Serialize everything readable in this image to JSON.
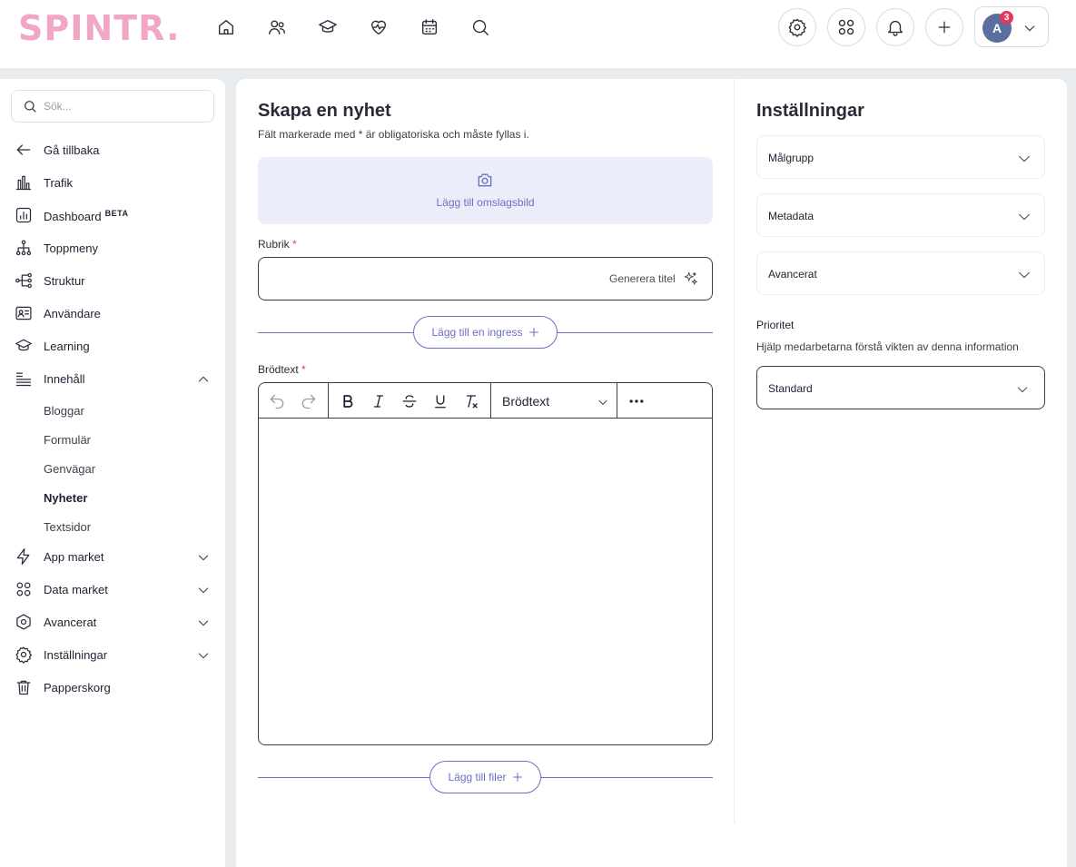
{
  "header": {
    "logo_text": "SPINTR.",
    "nav_icons": [
      "home-icon",
      "people-icon",
      "graduation-cap-icon",
      "heart-pulse-icon",
      "calendar-icon",
      "search-icon"
    ],
    "action_icons": [
      "gear-icon",
      "apps-grid-icon",
      "bell-icon",
      "plus-icon"
    ],
    "user": {
      "initial": "A",
      "notification_count": "3"
    }
  },
  "sidebar": {
    "search_placeholder": "Sök...",
    "items": [
      {
        "label": "Gå tillbaka",
        "icon": "arrow-left-icon"
      },
      {
        "label": "Trafik",
        "icon": "bar-chart-icon"
      },
      {
        "label": "Dashboard",
        "badge": "BETA",
        "icon": "dashboard-icon"
      },
      {
        "label": "Toppmeny",
        "icon": "sitemap-icon"
      },
      {
        "label": "Struktur",
        "icon": "hierarchy-icon"
      },
      {
        "label": "Användare",
        "icon": "id-card-icon"
      },
      {
        "label": "Learning",
        "icon": "graduation-cap-icon"
      },
      {
        "label": "Innehåll",
        "icon": "list-icon",
        "expanded": true
      }
    ],
    "sub_items": [
      {
        "label": "Bloggar"
      },
      {
        "label": "Formulär"
      },
      {
        "label": "Genvägar"
      },
      {
        "label": "Nyheter",
        "active": true
      },
      {
        "label": "Textsidor"
      }
    ],
    "bottom_items": [
      {
        "label": "App market",
        "icon": "lightning-icon"
      },
      {
        "label": "Data market",
        "icon": "grid-icon"
      },
      {
        "label": "Avancerat",
        "icon": "hexagon-icon"
      },
      {
        "label": "Inställningar",
        "icon": "gear-icon"
      },
      {
        "label": "Papperskorg",
        "icon": "trash-icon"
      }
    ]
  },
  "form": {
    "title": "Skapa en nyhet",
    "hint": "Fält markerade med * är obligatoriska och måste fyllas i.",
    "cover_label": "Lägg till omslagsbild",
    "headline_label": "Rubrik",
    "required_mark": "*",
    "headline_value": "",
    "generate_title": "Generera titel",
    "add_ingress": "Lägg till en ingress",
    "body_label": "Brödtext",
    "text_style": "Brödtext",
    "add_files": "Lägg till filer"
  },
  "settings": {
    "title": "Inställningar",
    "accordions": [
      {
        "label": "Målgrupp"
      },
      {
        "label": "Metadata"
      },
      {
        "label": "Avancerat"
      }
    ],
    "priority_label": "Prioritet",
    "priority_hint": "Hjälp medarbetarna förstå vikten av denna information",
    "priority_value": "Standard"
  },
  "colors": {
    "accent": "#6b6fc4",
    "logo": "#f2a6c6",
    "required": "#e23a5e",
    "cover_bg": "#ecedfa"
  }
}
